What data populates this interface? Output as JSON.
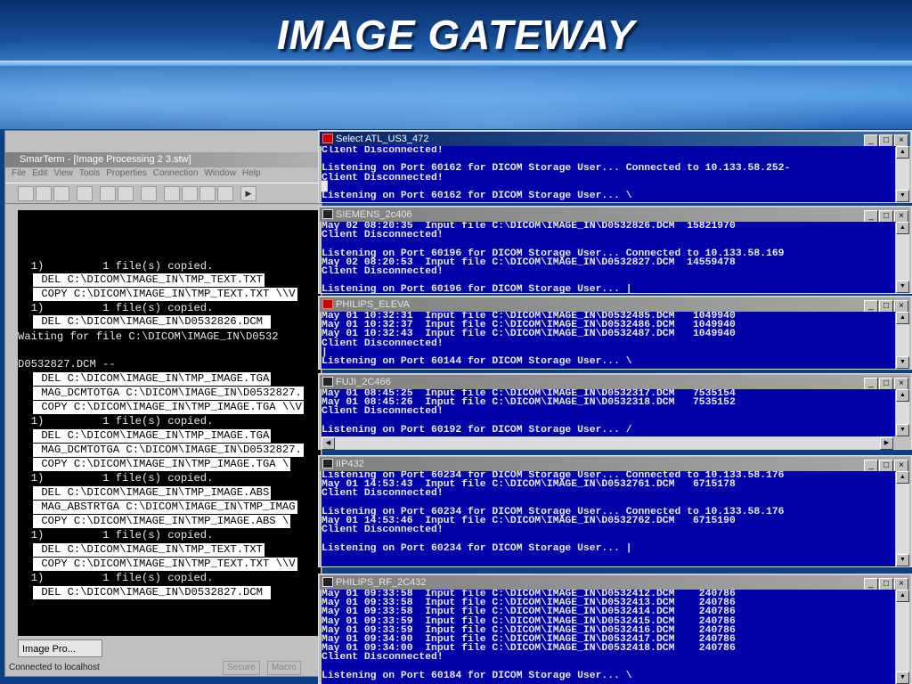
{
  "slide": {
    "title": "IMAGE GATEWAY"
  },
  "left_window": {
    "title": "SmarTerm - [Image Processing 2 3.stw]",
    "menu": [
      "File",
      "Edit",
      "View",
      "Tools",
      "Properties",
      "Connection",
      "Window",
      "Help"
    ],
    "terminal_lines": [
      {
        "text": "  1)         1 file(s) copied.",
        "hl": false
      },
      {
        "text": " DEL C:\\DICOM\\IMAGE_IN\\TMP_TEXT.TXT",
        "hl": true
      },
      {
        "text": " COPY C:\\DICOM\\IMAGE_IN\\TMP_TEXT.TXT \\\\V",
        "hl": true
      },
      {
        "text": "  1)         1 file(s) copied.",
        "hl": false
      },
      {
        "text": " DEL C:\\DICOM\\IMAGE_IN\\D0532826.DCM ",
        "hl": true
      },
      {
        "text": "Waiting for file C:\\DICOM\\IMAGE_IN\\D0532",
        "hl": false
      },
      {
        "text": "",
        "hl": false
      },
      {
        "text": "D0532827.DCM --",
        "hl": false
      },
      {
        "text": " DEL C:\\DICOM\\IMAGE_IN\\TMP_IMAGE.TGA",
        "hl": true
      },
      {
        "text": " MAG_DCMTOTGA C:\\DICOM\\IMAGE_IN\\D0532827.",
        "hl": true
      },
      {
        "text": " COPY C:\\DICOM\\IMAGE_IN\\TMP_IMAGE.TGA \\\\V",
        "hl": true
      },
      {
        "text": "  1)         1 file(s) copied.",
        "hl": false
      },
      {
        "text": " DEL C:\\DICOM\\IMAGE_IN\\TMP_IMAGE.TGA",
        "hl": true
      },
      {
        "text": " MAG_DCMTOTGA C:\\DICOM\\IMAGE_IN\\D0532827.",
        "hl": true
      },
      {
        "text": " COPY C:\\DICOM\\IMAGE_IN\\TMP_IMAGE.TGA \\",
        "hl": true
      },
      {
        "text": "  1)         1 file(s) copied.",
        "hl": false
      },
      {
        "text": " DEL C:\\DICOM\\IMAGE_IN\\TMP_IMAGE.ABS",
        "hl": true
      },
      {
        "text": " MAG_ABSTRTGA C:\\DICOM\\IMAGE_IN\\TMP_IMAG",
        "hl": true
      },
      {
        "text": " COPY C:\\DICOM\\IMAGE_IN\\TMP_IMAGE.ABS \\",
        "hl": true
      },
      {
        "text": "  1)         1 file(s) copied.",
        "hl": false
      },
      {
        "text": " DEL C:\\DICOM\\IMAGE_IN\\TMP_TEXT.TXT",
        "hl": true
      },
      {
        "text": " COPY C:\\DICOM\\IMAGE_IN\\TMP_TEXT.TXT \\\\V",
        "hl": true
      },
      {
        "text": "  1)         1 file(s) copied.",
        "hl": false
      },
      {
        "text": " DEL C:\\DICOM\\IMAGE_IN\\D0532827.DCM ",
        "hl": true
      }
    ],
    "taskbar_button": "Image Pro...",
    "status": "Connected to localhost",
    "status_cells": [
      "Secure",
      "Macro"
    ]
  },
  "console_windows": [
    {
      "title": "Select ATL_US3_472",
      "active": true,
      "lines": [
        "Client Disconnected!",
        "",
        "Listening on Port 60162 for DICOM Storage User... Connected to 10.133.58.252-",
        "Client Disconnected!",
        "█",
        "Listening on Port 60162 for DICOM Storage User... \\"
      ]
    },
    {
      "title": "SIEMENS_2c406",
      "active": false,
      "lines": [
        "May 02 08:20:35  Input file C:\\DICOM\\IMAGE_IN\\D0532826.DCM  15821970",
        "Client Disconnected!",
        "",
        "Listening on Port 60196 for DICOM Storage User... Connected to 10.133.58.169",
        "May 02 08:20:53  Input file C:\\DICOM\\IMAGE_IN\\D0532827.DCM  14559478",
        "Client Disconnected!",
        "",
        "Listening on Port 60196 for DICOM Storage User... |"
      ]
    },
    {
      "title": "PHILIPS_ELEVA",
      "active": false,
      "lines": [
        "May 01 10:32:31  Input file C:\\DICOM\\IMAGE_IN\\D0532485.DCM   1049940",
        "May 01 10:32:37  Input file C:\\DICOM\\IMAGE_IN\\D0532486.DCM   1049940",
        "May 01 10:32:43  Input file C:\\DICOM\\IMAGE_IN\\D0532487.DCM   1049940",
        "Client Disconnected!",
        "|",
        "Listening on Port 60144 for DICOM Storage User... \\"
      ]
    },
    {
      "title": "FUJI_2C466",
      "active": false,
      "lines": [
        "May 01 08:45:25  Input file C:\\DICOM\\IMAGE_IN\\D0532317.DCM   7535154",
        "May 01 08:45:26  Input file C:\\DICOM\\IMAGE_IN\\D0532318.DCM   7535152",
        "Client Disconnected!",
        "",
        "Listening on Port 60192 for DICOM Storage User... /"
      ]
    },
    {
      "title": "IIP432",
      "active": false,
      "lines": [
        "Listening on Port 60234 for DICOM Storage User... Connected to 10.133.58.176",
        "May 01 14:53:43  Input file C:\\DICOM\\IMAGE_IN\\D0532761.DCM   6715178",
        "Client Disconnected!",
        "",
        "Listening on Port 60234 for DICOM Storage User... Connected to 10.133.58.176",
        "May 01 14:53:46  Input file C:\\DICOM\\IMAGE_IN\\D0532762.DCM   6715190",
        "Client Disconnected!",
        "",
        "Listening on Port 60234 for DICOM Storage User... |"
      ]
    },
    {
      "title": "PHILIPS_RF_2C432",
      "active": false,
      "lines": [
        "May 01 09:33:58  Input file C:\\DICOM\\IMAGE_IN\\D0532412.DCM    240786",
        "May 01 09:33:58  Input file C:\\DICOM\\IMAGE_IN\\D0532413.DCM    240786",
        "May 01 09:33:58  Input file C:\\DICOM\\IMAGE_IN\\D0532414.DCM    240786",
        "May 01 09:33:59  Input file C:\\DICOM\\IMAGE_IN\\D0532415.DCM    240786",
        "May 01 09:33:59  Input file C:\\DICOM\\IMAGE_IN\\D0532416.DCM    240786",
        "May 01 09:34:00  Input file C:\\DICOM\\IMAGE_IN\\D0532417.DCM    240786",
        "May 01 09:34:00  Input file C:\\DICOM\\IMAGE_IN\\D0532418.DCM    240786",
        "Client Disconnected!",
        "",
        "Listening on Port 60184 for DICOM Storage User... \\"
      ]
    }
  ],
  "window_buttons": {
    "minimize": "_",
    "maximize": "□",
    "close": "×"
  }
}
